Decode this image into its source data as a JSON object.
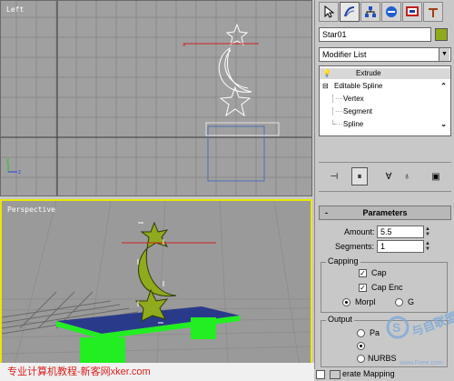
{
  "viewports": {
    "left_label": "Left",
    "perspective_label": "Perspective"
  },
  "toolbar": {
    "tabs": [
      {
        "icon": "create-icon"
      },
      {
        "icon": "modify-icon"
      },
      {
        "icon": "hierarchy-icon"
      },
      {
        "icon": "motion-icon"
      },
      {
        "icon": "display-icon"
      },
      {
        "icon": "utilities-icon"
      }
    ]
  },
  "object": {
    "name": "Star01",
    "color": "#8faa1c"
  },
  "modifier_list": {
    "value": "Modifier List"
  },
  "stack": {
    "items": [
      {
        "label": "Extrude",
        "selected": true
      },
      {
        "label": "Editable Spline",
        "expanded": true
      },
      {
        "label": "Vertex"
      },
      {
        "label": "Segment"
      },
      {
        "label": "Spline"
      }
    ]
  },
  "stack_buttons": [
    "pin-stack-icon",
    "show-end-result-icon",
    "make-unique-icon",
    "remove-modifier-icon",
    "configure-sets-icon"
  ],
  "parameters": {
    "title": "Parameters",
    "collapse_sign": "-",
    "amount_label": "Amount:",
    "amount_value": "5.5",
    "segments_label": "Segments:",
    "segments_value": "1",
    "capping_title": "Capping",
    "cap_start_label": "Cap",
    "cap_end_label": "Cap Enc",
    "morph_label": "Morpl",
    "grid_label": "G",
    "output_title": "Output",
    "patch_label": "Pa",
    "nurbs_label": "NURBS",
    "gen_mapping_label": "erate Mapping"
  },
  "footer": {
    "text": "专业计算机教程-新客网xker.com"
  },
  "watermark": {
    "text": "与自联盟",
    "url": "www.Feee.com"
  },
  "colors": {
    "viewport_bg": "#a0a0a0",
    "grid": "#8a8a8a",
    "grid_dark": "#404040",
    "active_border": "#e8e800",
    "star_color": "#8faa1c",
    "table_green": "#22ee22"
  }
}
